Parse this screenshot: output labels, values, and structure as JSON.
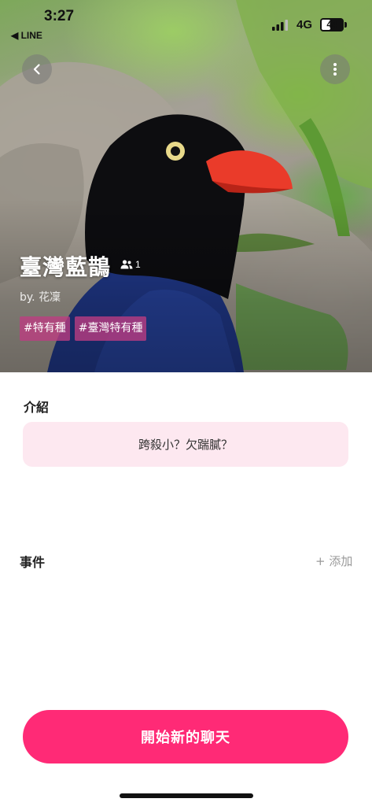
{
  "status_bar": {
    "time": "3:27",
    "back_app": "◀ LINE",
    "network": "4G",
    "battery_level": "44",
    "battery_fraction": 0.44
  },
  "hero": {
    "back_icon": "chevron-left-icon",
    "more_icon": "more-vertical-icon",
    "name": "臺灣藍鵲",
    "member_icon": "users-icon",
    "member_count": "1",
    "author": "by. 花凜",
    "tags": [
      "#特有種",
      "#臺灣特有種"
    ]
  },
  "intro": {
    "title": "介紹",
    "text": "跨殺小？欠踹膩？"
  },
  "events": {
    "title": "事件",
    "add_label": "+ 添加"
  },
  "cta": {
    "start_label": "開始新的聊天"
  },
  "colors": {
    "accent": "#ff2a76",
    "intro_bg": "#fde8f0",
    "tag_bg": "#be3c82"
  }
}
